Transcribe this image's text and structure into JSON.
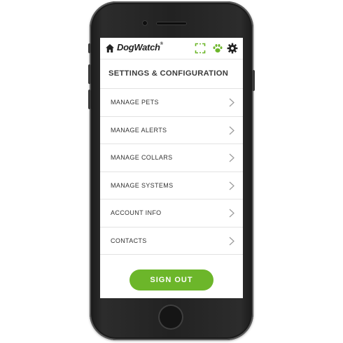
{
  "header": {
    "brand": "DogWatch",
    "brand_mark": "®",
    "icons": [
      "home-icon",
      "fullscreen-icon",
      "paw-icon",
      "gear-icon"
    ],
    "accent": "#6cb62a"
  },
  "page": {
    "title": "SETTINGS & CONFIGURATION"
  },
  "menu": {
    "items": [
      {
        "label": "MANAGE PETS"
      },
      {
        "label": "MANAGE ALERTS"
      },
      {
        "label": "MANAGE COLLARS"
      },
      {
        "label": "MANAGE SYSTEMS"
      },
      {
        "label": "ACCOUNT INFO"
      },
      {
        "label": "CONTACTS"
      }
    ]
  },
  "actions": {
    "sign_out_label": "SIGN OUT"
  }
}
